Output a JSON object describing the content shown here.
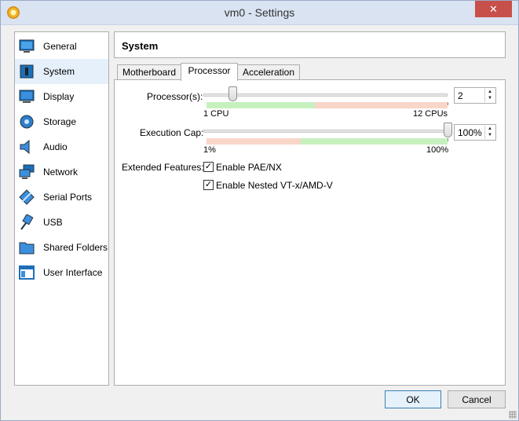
{
  "window": {
    "title": "vm0 - Settings",
    "close_glyph": "✕"
  },
  "sidebar": {
    "items": [
      {
        "label": "General",
        "icon": "monitor-icon"
      },
      {
        "label": "System",
        "icon": "chip-icon"
      },
      {
        "label": "Display",
        "icon": "display-icon"
      },
      {
        "label": "Storage",
        "icon": "disk-icon"
      },
      {
        "label": "Audio",
        "icon": "speaker-icon"
      },
      {
        "label": "Network",
        "icon": "network-icon"
      },
      {
        "label": "Serial Ports",
        "icon": "serial-port-icon"
      },
      {
        "label": "USB",
        "icon": "usb-icon"
      },
      {
        "label": "Shared Folders",
        "icon": "folder-icon"
      },
      {
        "label": "User Interface",
        "icon": "window-icon"
      }
    ],
    "selected": "System"
  },
  "page": {
    "title": "System"
  },
  "tabs": [
    {
      "label": "Motherboard"
    },
    {
      "label": "Processor"
    },
    {
      "label": "Acceleration"
    }
  ],
  "active_tab": "Processor",
  "processor": {
    "label": "Processor(s):",
    "value": "2",
    "min_label": "1 CPU",
    "max_label": "12 CPUs",
    "slider_fraction": 0.09
  },
  "exec_cap": {
    "label": "Execution Cap:",
    "value": "100%",
    "min_label": "1%",
    "max_label": "100%",
    "slider_fraction": 1.0
  },
  "extended": {
    "label": "Extended Features:",
    "options": [
      {
        "label": "Enable PAE/NX",
        "checked": true
      },
      {
        "label": "Enable Nested VT-x/AMD-V",
        "checked": true
      }
    ]
  },
  "buttons": {
    "ok": "OK",
    "cancel": "Cancel"
  },
  "colors": {
    "accent": "#3c7fb1",
    "safe": "#c6f1bf",
    "warn": "#f8d6c8",
    "close": "#c7504a"
  }
}
